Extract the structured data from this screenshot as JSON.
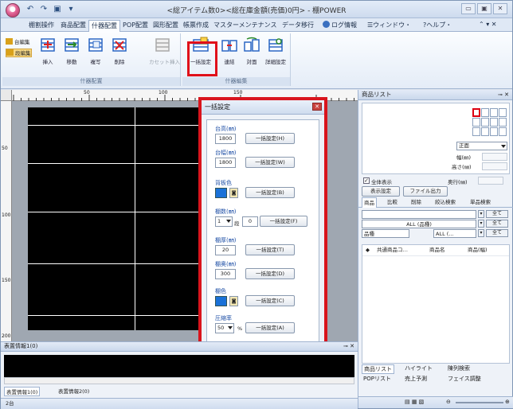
{
  "window": {
    "title": "<総アイテム数0><総在庫金額(売価)0円> - 棚POWER",
    "controls": [
      "▭",
      "▣",
      "✕"
    ]
  },
  "ribbon_tabs": [
    {
      "label": "棚割操作"
    },
    {
      "label": "商品配置"
    },
    {
      "label": "什器配置",
      "active": true
    },
    {
      "label": "POP配置"
    },
    {
      "label": "図形配置"
    },
    {
      "label": "帳票作成"
    },
    {
      "label": "マスターメンテナンス"
    },
    {
      "label": "データ移行"
    }
  ],
  "ribbon_right": {
    "log": "ログ情報",
    "window": "ウィンドウ・",
    "help": "ヘルプ・"
  },
  "ribbon": {
    "small_buttons": [
      "台編集",
      "段編集"
    ],
    "group1_buttons": [
      "挿入",
      "移動",
      "複写",
      "削除"
    ],
    "disabled_button": "カセット挿入",
    "group2_buttons": [
      "一括設定",
      "連結",
      "対面",
      "詳細設定"
    ],
    "group1_label": "什器配置",
    "group2_label": "什器編集"
  },
  "rulers": {
    "top_marks": [
      "50",
      "100",
      "150"
    ],
    "left_marks": [
      "50",
      "100",
      "150",
      "200"
    ]
  },
  "dialog": {
    "title": "一括設定",
    "height": {
      "label": "台高(㎜)",
      "value": "1800",
      "button": "一括設定(H)"
    },
    "width": {
      "label": "台幅(㎜)",
      "value": "1800",
      "button": "一括設定(W)"
    },
    "backboard": {
      "label": "背板色",
      "button": "一括設定(B)"
    },
    "shelves": {
      "label": "棚数(㎜)",
      "combo": "1",
      "unit": "段",
      "value": "0",
      "button": "一括設定(F)"
    },
    "thickness": {
      "label": "棚厚(㎜)",
      "value": "20",
      "button": "一括設定(T)"
    },
    "depth": {
      "label": "棚奥(㎜)",
      "value": "300",
      "button": "一括設定(D)"
    },
    "shelf_color": {
      "label": "棚色",
      "button": "一括設定(C)"
    },
    "compression": {
      "label": "圧縮率",
      "combo": "50",
      "unit": "%",
      "button": "一括設定(A)"
    }
  },
  "right_panel": {
    "title": "商品リスト",
    "view_combo": "正面",
    "dims": [
      "幅(㎜)",
      "高さ(㎜)",
      "奥行(㎜)"
    ],
    "show_all": "全体表示",
    "show_settings": "表示設定",
    "file_output": "ファイル出力",
    "tabs": [
      "商品",
      "比較",
      "削除",
      "絞込検索",
      "単品検索"
    ],
    "filters": [
      {
        "label": "",
        "all": "全て"
      },
      {
        "label": "ALL (品種)",
        "all": "全て"
      },
      {
        "label": "品種",
        "mid": "ALL (…",
        "all": "全て"
      }
    ],
    "columns": [
      "共通商品コ…",
      "商品名",
      "商品(幅)"
    ],
    "bottom_tabs": [
      "商品リスト",
      "ハイライト",
      "陳列検索",
      "POPリスト",
      "売上予測",
      "フェイス調整"
    ]
  },
  "bottom_panel": {
    "title": "表置情報1(0)",
    "tabs": [
      "表置情報1(0)",
      "表置情報2(0)"
    ],
    "status": "2台"
  },
  "colors": {
    "accent": "#d9141c",
    "shelf": "#000000",
    "swatch": "#1a71d8"
  }
}
